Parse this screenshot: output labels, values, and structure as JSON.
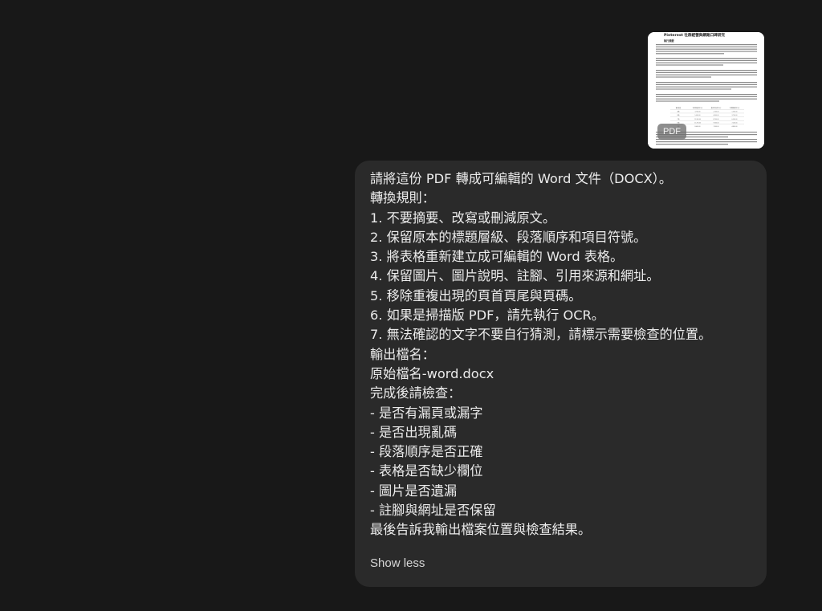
{
  "attachment": {
    "type_label": "PDF",
    "thumbnail_title": "Pinterest 社群經營與網路口碑研究",
    "thumbnail_subtitle": "執行摘要",
    "thumbnail_table": {
      "headers": [
        "資料類型",
        "社群經營成本(元)",
        "廣告曝光成本(元)",
        "口碑擴散成本(元)"
      ],
      "rows": [
        [
          "A類",
          "3,700.00",
          "2,100.00",
          "1,300.00"
        ],
        [
          "B類",
          "5,000.00",
          "4,500.00",
          "3,700.00"
        ],
        [
          "C類",
          "12,300.00",
          "8,700.00",
          "6,500.00"
        ],
        [
          "D類",
          "11,700.00",
          "9,500.00",
          "7,200.00"
        ],
        [
          "E類",
          "8,600.00",
          "7,000.00",
          "4,800.00"
        ]
      ]
    }
  },
  "message": {
    "lines": [
      "請將這份 PDF 轉成可編輯的 Word 文件（DOCX）。",
      "轉換規則：",
      "1. 不要摘要、改寫或刪減原文。",
      "2. 保留原本的標題層級、段落順序和項目符號。",
      "3. 將表格重新建立成可編輯的 Word 表格。",
      "4. 保留圖片、圖片說明、註腳、引用來源和網址。",
      "5. 移除重複出現的頁首頁尾與頁碼。",
      "6. 如果是掃描版 PDF，請先執行 OCR。",
      "7. 無法確認的文字不要自行猜測，請標示需要檢查的位置。",
      "輸出檔名：",
      "原始檔名-word.docx",
      "完成後請檢查：",
      "- 是否有漏頁或漏字",
      "- 是否出現亂碼",
      "- 段落順序是否正確",
      "- 表格是否缺少欄位",
      "- 圖片是否遺漏",
      "- 註腳與網址是否保留",
      "最後告訴我輸出檔案位置與檢查結果。"
    ],
    "toggle_label": "Show less"
  },
  "colors": {
    "background": "#181818",
    "bubble": "#2a2a2a",
    "text": "#ececec"
  }
}
